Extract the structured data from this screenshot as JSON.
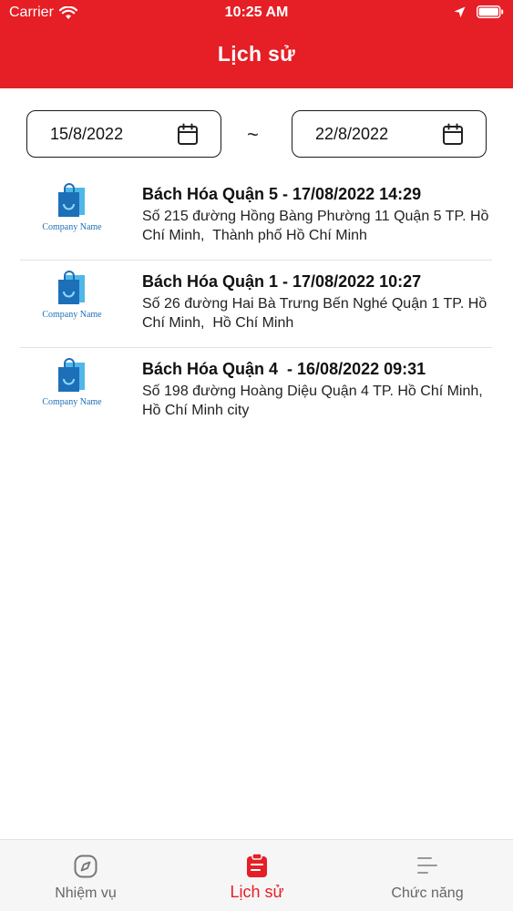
{
  "status_bar": {
    "carrier": "Carrier",
    "time": "10:25 AM"
  },
  "header": {
    "title": "Lịch sử"
  },
  "date_range": {
    "from": "15/8/2022",
    "separator": "~",
    "to": "22/8/2022"
  },
  "history": [
    {
      "logo_text": "Company Name",
      "title": "Bách Hóa Quận 5 - 17/08/2022 14:29",
      "address": "Số 215 đường Hồng Bàng Phường 11 Quận 5 TP. Hồ Chí Minh,  Thành phố Hồ Chí Minh"
    },
    {
      "logo_text": "Company Name",
      "title": "Bách Hóa Quận 1 - 17/08/2022 10:27",
      "address": "Số 26 đường Hai Bà Trưng Bến Nghé Quận 1 TP. Hồ Chí Minh,  Hồ Chí Minh"
    },
    {
      "logo_text": "Company Name",
      "title": "Bách Hóa Quận 4  - 16/08/2022 09:31",
      "address": "Số 198 đường Hoàng Diệu Quận 4 TP. Hồ Chí Minh,  Hồ Chí Minh city"
    }
  ],
  "tabs": [
    {
      "label": "Nhiệm vụ",
      "icon": "compass-icon"
    },
    {
      "label": "Lịch sử",
      "icon": "clipboard-icon",
      "active": true
    },
    {
      "label": "Chức năng",
      "icon": "menu-lines-icon"
    }
  ],
  "colors": {
    "brand_red": "#e61e25",
    "logo_blue": "#1f6fb5",
    "tab_inactive": "#666666"
  }
}
